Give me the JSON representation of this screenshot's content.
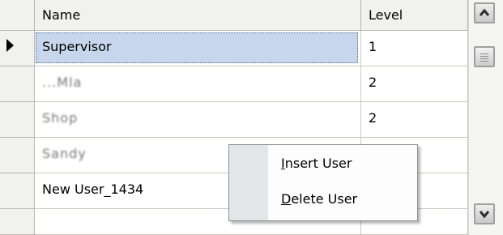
{
  "grid": {
    "columns": [
      {
        "label": "Name"
      },
      {
        "label": "Level"
      }
    ],
    "rows": [
      {
        "name": "Supervisor",
        "level": "1",
        "current": true,
        "selected": true,
        "redacted": false
      },
      {
        "name": "...Mla",
        "level": "2",
        "current": false,
        "selected": false,
        "redacted": true
      },
      {
        "name": "Shop",
        "level": "2",
        "current": false,
        "selected": false,
        "redacted": true
      },
      {
        "name": "Sandy",
        "level": "",
        "current": false,
        "selected": false,
        "redacted": true
      },
      {
        "name": "New User_1434",
        "level": "",
        "current": false,
        "selected": false,
        "redacted": false
      }
    ]
  },
  "context_menu": {
    "items": [
      {
        "mnemonic": "I",
        "rest": "nsert User"
      },
      {
        "mnemonic": "D",
        "rest": "elete User"
      }
    ]
  },
  "colors": {
    "header_bg": "#f1f1ee",
    "selection_bg": "#c7d6ec",
    "menu_gutter": "#e4e6ea"
  },
  "icons": {
    "row_indicator": "current-row-arrow-icon",
    "scroll_up": "chevron-up-icon",
    "scroll_down": "chevron-down-icon"
  }
}
